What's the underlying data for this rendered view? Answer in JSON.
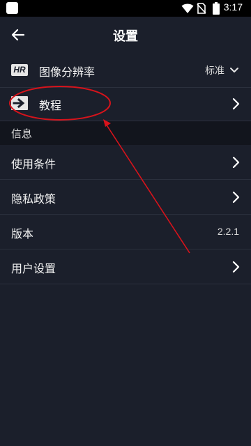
{
  "status_bar": {
    "time": "3:17",
    "icons": [
      "app-square-icon",
      "wifi-icon",
      "no-sim-icon",
      "battery-icon"
    ]
  },
  "app_bar": {
    "back_icon": "arrow-left-icon",
    "title": "设置"
  },
  "resolution_row": {
    "icon_text": "HR",
    "label": "图像分辨率",
    "value": "标准",
    "dropdown_icon": "chevron-down-icon"
  },
  "tutorial_row": {
    "icon": "arrow-right-box-icon",
    "label": "教程",
    "chevron_icon": "chevron-right-icon"
  },
  "info_section": {
    "header": "信息"
  },
  "terms_row": {
    "label": "使用条件",
    "chevron_icon": "chevron-right-icon"
  },
  "privacy_row": {
    "label": "隐私政策",
    "chevron_icon": "chevron-right-icon"
  },
  "version_row": {
    "label": "版本",
    "value": "2.2.1"
  },
  "user_settings_row": {
    "label": "用户设置",
    "chevron_icon": "chevron-right-icon"
  },
  "annotation": {
    "color": "#d8131b"
  }
}
